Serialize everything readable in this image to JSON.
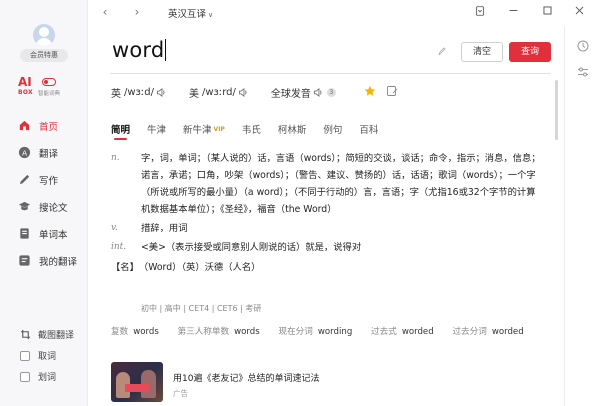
{
  "app": {
    "mode": "英汉互译",
    "colors": {
      "accent": "#e0303b",
      "star": "#f5b400"
    }
  },
  "sidebar": {
    "member_label": "会员特惠",
    "ai": {
      "logo": "AI",
      "box": "BOX",
      "desc": "智能词典"
    },
    "items": [
      {
        "label": "首页",
        "icon": "home-icon",
        "active": true
      },
      {
        "label": "翻译",
        "icon": "translate-icon",
        "active": false
      },
      {
        "label": "写作",
        "icon": "write-icon",
        "active": false
      },
      {
        "label": "搜论文",
        "icon": "paper-search-icon",
        "active": false
      },
      {
        "label": "单词本",
        "icon": "wordbook-icon",
        "active": false
      },
      {
        "label": "我的翻译",
        "icon": "my-translation-icon",
        "active": false
      }
    ],
    "tools": [
      {
        "label": "截图翻译",
        "icon": "crop-icon"
      },
      {
        "label": "取词",
        "icon": "checkbox"
      },
      {
        "label": "划词",
        "icon": "checkbox"
      }
    ]
  },
  "search": {
    "value": "word",
    "clear_label": "清空",
    "search_label": "查询"
  },
  "pronunciation": {
    "uk_label": "英",
    "uk_ipa": "/wɜːd/",
    "us_label": "美",
    "us_ipa": "/wɜːrd/",
    "global_label": "全球发音",
    "global_count": "3"
  },
  "tabs": [
    {
      "label": "简明",
      "active": true,
      "vip": ""
    },
    {
      "label": "牛津",
      "active": false,
      "vip": ""
    },
    {
      "label": "新牛津",
      "active": false,
      "vip": "VIP"
    },
    {
      "label": "韦氏",
      "active": false,
      "vip": ""
    },
    {
      "label": "柯林斯",
      "active": false,
      "vip": ""
    },
    {
      "label": "例句",
      "active": false,
      "vip": ""
    },
    {
      "label": "百科",
      "active": false,
      "vip": ""
    }
  ],
  "definitions": [
    {
      "pos": "n.",
      "text": "字，词，单词；（某人说的）话，言语（words）；简短的交谈，谈话；命令，指示；消息，信息；诺言，承诺；口角，吵架（words）；（警告、建议、赞扬的）话，话语；歌词（words）；一个字（所说或所写的最小量）（a word）；（不同于行动的）言，言语；字（尤指16或32个字节的计算机数据基本单位）；《圣经》，福音（the Word）"
    },
    {
      "pos": "v.",
      "text": "措辞，用词"
    },
    {
      "pos": "int.",
      "text": "<美>（表示接受或同意别人刚说的话）就是，说得对"
    }
  ],
  "name_entry": {
    "tag": "【名】",
    "text": "（Word）（英）沃德（人名）"
  },
  "levels": "初中 | 高中 | CET4 | CET6 | 考研",
  "forms": [
    {
      "key": "复数",
      "value": "words"
    },
    {
      "key": "第三人称单数",
      "value": "words"
    },
    {
      "key": "现在分词",
      "value": "wording"
    },
    {
      "key": "过去式",
      "value": "worded"
    },
    {
      "key": "过去分词",
      "value": "worded"
    }
  ],
  "ad": {
    "title": "用10遍《老友记》总结的单词速记法",
    "tag": "广告"
  }
}
